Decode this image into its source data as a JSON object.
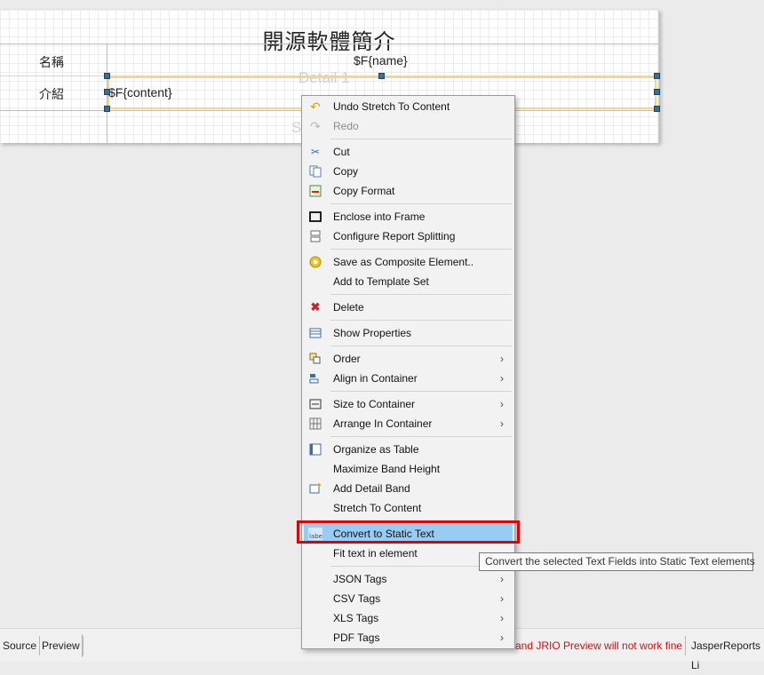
{
  "report": {
    "title": "開源軟體簡介",
    "rows": [
      {
        "label": "名稱",
        "field": "$F{name}"
      },
      {
        "label": "介紹",
        "field": "$F{content}"
      }
    ],
    "detail_band_name": "Detail 1",
    "summary_band_fragment": "S"
  },
  "context_menu": {
    "groups": [
      [
        {
          "label": "Undo Stretch To Content",
          "icon": "undo-icon",
          "enabled": true
        },
        {
          "label": "Redo",
          "icon": "redo-icon",
          "enabled": false
        }
      ],
      [
        {
          "label": "Cut",
          "icon": "scissors-icon",
          "enabled": true
        },
        {
          "label": "Copy",
          "icon": "copy-icon",
          "enabled": true
        },
        {
          "label": "Copy Format",
          "icon": "copy-format-icon",
          "enabled": true
        }
      ],
      [
        {
          "label": "Enclose into Frame",
          "icon": "frame-icon",
          "enabled": true
        },
        {
          "label": "Configure Report Splitting",
          "icon": "split-icon",
          "enabled": true
        }
      ],
      [
        {
          "label": "Save as Composite Element..",
          "icon": "composite-icon",
          "enabled": true
        },
        {
          "label": "Add to Template Set",
          "icon": "",
          "enabled": true
        }
      ],
      [
        {
          "label": "Delete",
          "icon": "delete-icon",
          "enabled": true
        }
      ],
      [
        {
          "label": "Show Properties",
          "icon": "properties-icon",
          "enabled": true
        }
      ],
      [
        {
          "label": "Order",
          "icon": "order-icon",
          "enabled": true,
          "submenu": true
        },
        {
          "label": "Align in Container",
          "icon": "align-icon",
          "enabled": true,
          "submenu": true
        }
      ],
      [
        {
          "label": "Size to Container",
          "icon": "size-icon",
          "enabled": true,
          "submenu": true
        },
        {
          "label": "Arrange In Container",
          "icon": "arrange-icon",
          "enabled": true,
          "submenu": true
        }
      ],
      [
        {
          "label": "Organize as Table",
          "icon": "table-icon",
          "enabled": true
        },
        {
          "label": "Maximize Band Height",
          "icon": "",
          "enabled": true
        },
        {
          "label": "Add Detail Band",
          "icon": "add-band-icon",
          "enabled": true
        },
        {
          "label": "Stretch To Content",
          "icon": "",
          "enabled": true
        }
      ],
      [
        {
          "label": "Convert to Static Text",
          "icon": "label-icon",
          "enabled": true,
          "highlighted": true
        },
        {
          "label": "Fit text in element",
          "icon": "",
          "enabled": true
        }
      ],
      [
        {
          "label": "JSON Tags",
          "icon": "",
          "enabled": true,
          "submenu": true
        },
        {
          "label": "CSV Tags",
          "icon": "",
          "enabled": true,
          "submenu": true
        },
        {
          "label": "XLS Tags",
          "icon": "",
          "enabled": true,
          "submenu": true
        },
        {
          "label": "PDF Tags",
          "icon": "",
          "enabled": true,
          "submenu": true
        }
      ]
    ]
  },
  "tooltip": "Convert the selected Text Fields into Static Text elements",
  "status_bar": {
    "tabs": [
      "Source",
      "Preview"
    ],
    "warning": "and JRIO Preview will not work fine",
    "product": "JasperReports Li"
  },
  "colors": {
    "highlight": "#99ccf5",
    "annotation_box": "#e00000",
    "selection_border": "#f0d78a",
    "warning_text": "#cc1111"
  }
}
